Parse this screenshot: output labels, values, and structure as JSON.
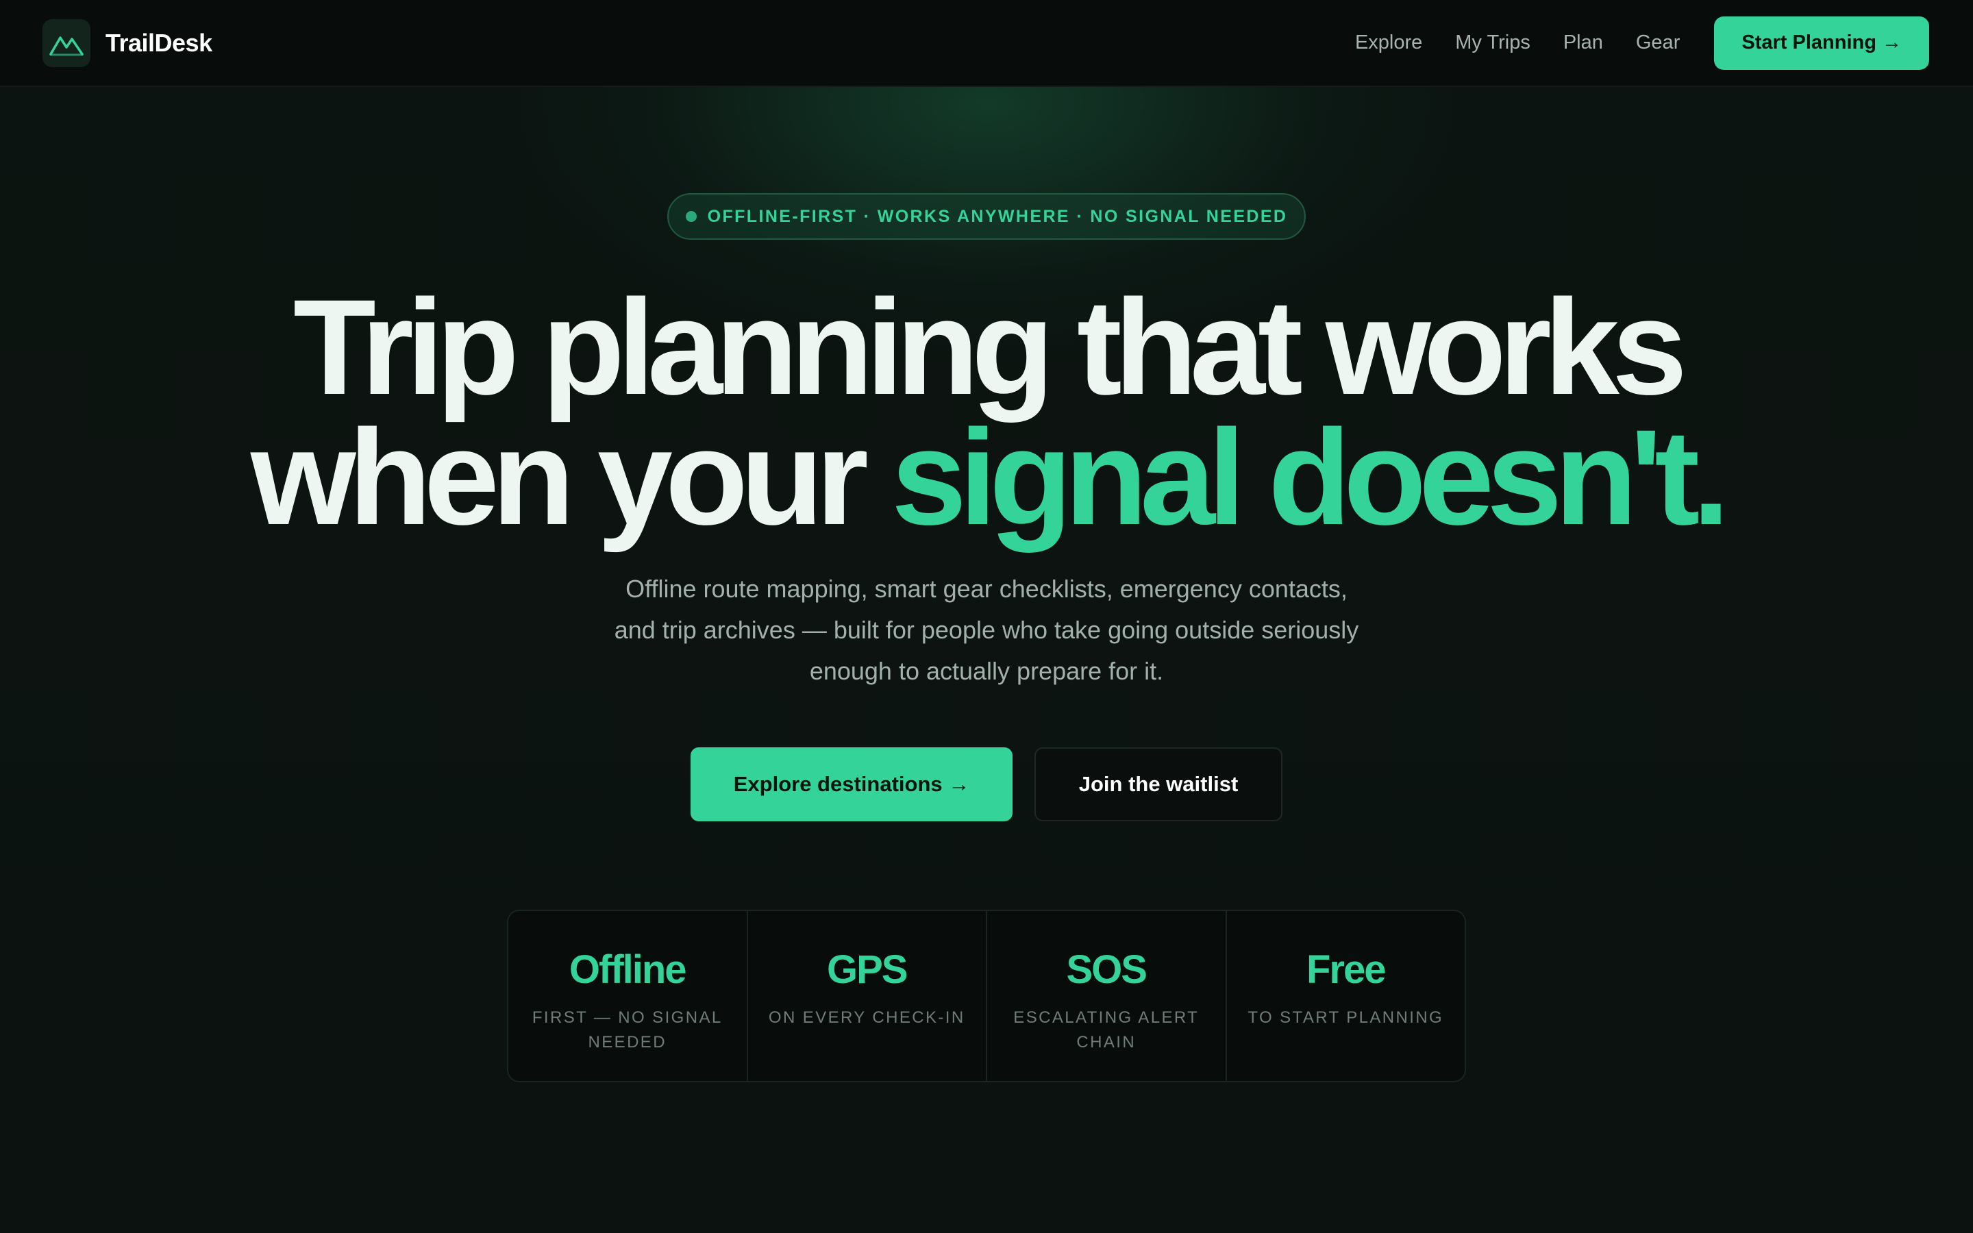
{
  "nav": {
    "brand": "TrailDesk",
    "links": [
      "Explore",
      "My Trips",
      "Plan",
      "Gear"
    ],
    "cta": "Start Planning →"
  },
  "hero": {
    "badge": "OFFLINE-FIRST · WORKS ANYWHERE · NO SIGNAL NEEDED",
    "headline_line1": "Trip planning that works",
    "headline_line2_plain": "when your ",
    "headline_line2_accent": "signal doesn't.",
    "subtitle": "Offline route mapping, smart gear checklists, emergency contacts, and trip archives — built for people who take going outside seriously enough to actually prepare for it.",
    "primary_button": "Explore destinations →",
    "secondary_button": "Join the waitlist"
  },
  "stats": [
    {
      "value": "Offline",
      "label": "FIRST — NO SIGNAL NEEDED"
    },
    {
      "value": "GPS",
      "label": "ON EVERY CHECK-IN"
    },
    {
      "value": "SOS",
      "label": "ESCALATING ALERT CHAIN"
    },
    {
      "value": "Free",
      "label": "TO START PLANNING"
    }
  ],
  "colors": {
    "accent": "#34d399",
    "background": "#0b120f",
    "nav_background": "#080c0b",
    "headline": "#eef6f2"
  },
  "icons": {
    "logo": "mountain-icon",
    "badge_dot": "status-dot-icon"
  }
}
